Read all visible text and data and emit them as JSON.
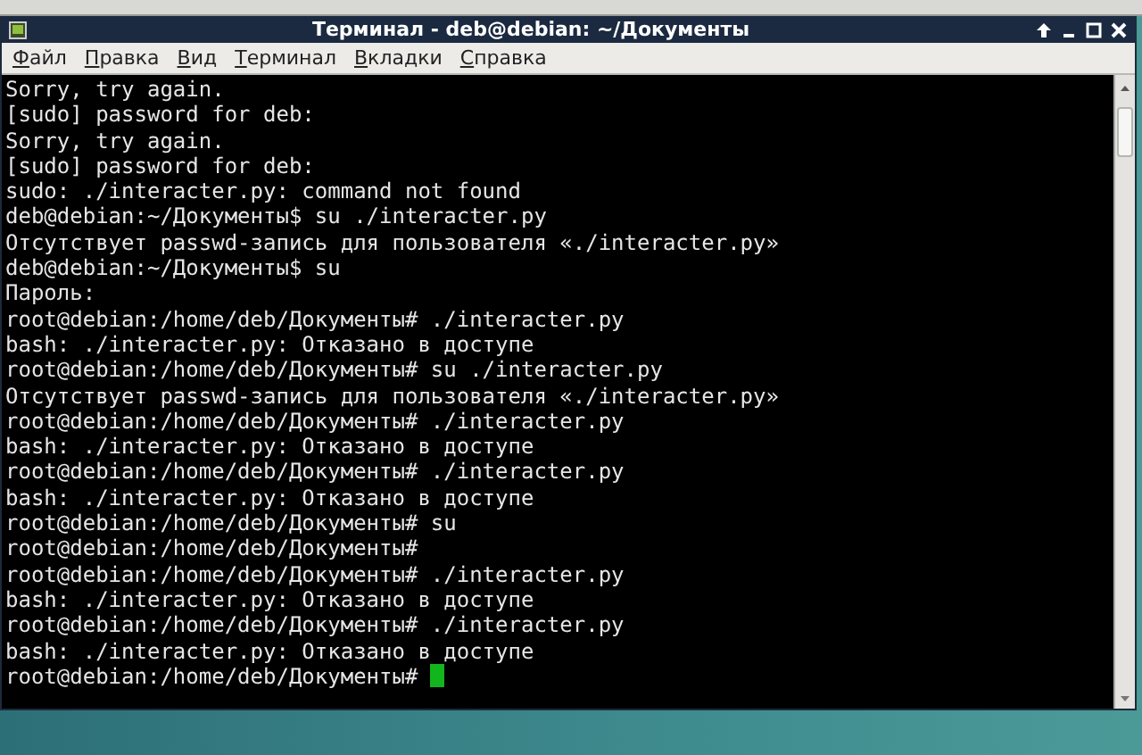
{
  "window": {
    "title": "Терминал - deb@debian: ~/Документы"
  },
  "menu": [
    "Файл",
    "Правка",
    "Вид",
    "Терминал",
    "Вкладки",
    "Справка"
  ],
  "terminal": {
    "lines": [
      "Sorry, try again.",
      "[sudo] password for deb:",
      "Sorry, try again.",
      "[sudo] password for deb:",
      "sudo: ./interacter.py: command not found",
      "deb@debian:~/Документы$ su ./interacter.py",
      "Отсутствует passwd-запись для пользователя «./interacter.py»",
      "deb@debian:~/Документы$ su",
      "Пароль:",
      "root@debian:/home/deb/Документы# ./interacter.py",
      "bash: ./interacter.py: Отказано в доступе",
      "root@debian:/home/deb/Документы# su ./interacter.py",
      "Отсутствует passwd-запись для пользователя «./interacter.py»",
      "root@debian:/home/deb/Документы# ./interacter.py",
      "bash: ./interacter.py: Отказано в доступе",
      "root@debian:/home/deb/Документы# ./interacter.py",
      "bash: ./interacter.py: Отказано в доступе",
      "root@debian:/home/deb/Документы# su",
      "root@debian:/home/deb/Документы#",
      "root@debian:/home/deb/Документы# ./interacter.py",
      "bash: ./interacter.py: Отказано в доступе",
      "root@debian:/home/deb/Документы# ./interacter.py",
      "bash: ./interacter.py: Отказано в доступе",
      "root@debian:/home/deb/Документы# "
    ]
  }
}
